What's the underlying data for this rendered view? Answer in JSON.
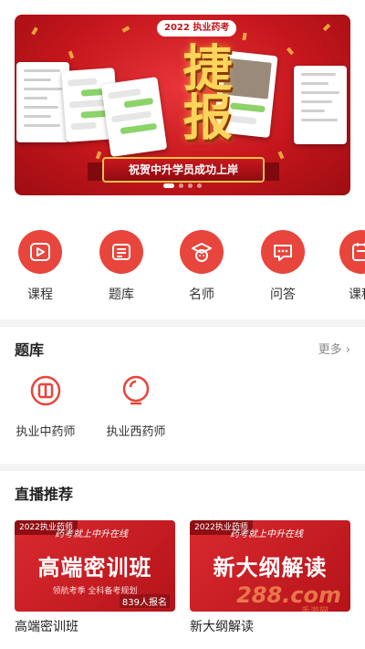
{
  "banner": {
    "tag": "2022 执业药考",
    "headline": "捷报",
    "ribbon": "祝贺中升学员成功上岸",
    "dots": 4,
    "active_dot": 0
  },
  "nav": {
    "items": [
      {
        "label": "课程",
        "icon": "play-video-icon"
      },
      {
        "label": "题库",
        "icon": "question-bank-icon"
      },
      {
        "label": "名师",
        "icon": "teacher-icon"
      },
      {
        "label": "问答",
        "icon": "chat-bubble-icon"
      },
      {
        "label": "课程",
        "icon": "calendar-icon"
      }
    ]
  },
  "question_bank": {
    "title": "题库",
    "more": "更多",
    "items": [
      {
        "label": "执业中药师",
        "icon": "herbal-medicine-icon"
      },
      {
        "label": "执业西药师",
        "icon": "western-medicine-icon"
      }
    ]
  },
  "live": {
    "title": "直播推荐",
    "courses": [
      {
        "tag": "2022执业药师",
        "slogan": "药考就上中升在线",
        "poster_title": "高端密训班",
        "poster_sub": "领航考季 全科备考规划",
        "count": "839人报名",
        "title": "高端密训班"
      },
      {
        "tag": "2022执业药师",
        "slogan": "药考就上中升在线",
        "poster_title": "新大纲解读",
        "poster_sub": "",
        "count": "",
        "title": "新大纲解读"
      }
    ]
  },
  "watermark": {
    "text": "288.com",
    "sub": "手游网"
  },
  "colors": {
    "brand_red": "#e8453c",
    "banner_red": "#c4161c",
    "gold": "#ffd45a"
  }
}
